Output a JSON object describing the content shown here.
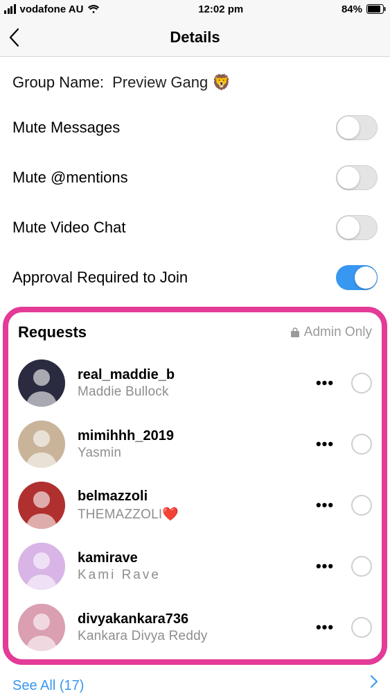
{
  "status_bar": {
    "carrier": "vodafone AU",
    "time": "12:02 pm",
    "battery_pct": "84%"
  },
  "header": {
    "title": "Details"
  },
  "group": {
    "label": "Group Name:",
    "value": "Preview Gang 🦁"
  },
  "toggles": {
    "mute_messages": {
      "label": "Mute Messages",
      "on": false
    },
    "mute_mentions": {
      "label": "Mute @mentions",
      "on": false
    },
    "mute_video": {
      "label": "Mute Video Chat",
      "on": false
    },
    "approval": {
      "label": "Approval Required to Join",
      "on": true
    }
  },
  "requests": {
    "title": "Requests",
    "admin_only": "Admin Only",
    "see_all_label": "See All (17)",
    "items": [
      {
        "username": "real_maddie_b",
        "displayname": "Maddie Bullock",
        "spaced": false
      },
      {
        "username": "mimihhh_2019",
        "displayname": "Yasmin",
        "spaced": false
      },
      {
        "username": "belmazzoli",
        "displayname": "THEMAZZOLI❤️",
        "spaced": false
      },
      {
        "username": "kamirave",
        "displayname": "Kami Rave",
        "spaced": true
      },
      {
        "username": "divyakankara736",
        "displayname": "Kankara Divya Reddy",
        "spaced": false
      }
    ],
    "avatar_bg": [
      "#2a2a40",
      "#c9b49a",
      "#b03030",
      "#d8b5e6",
      "#da9fb1"
    ]
  },
  "dots": "•••"
}
